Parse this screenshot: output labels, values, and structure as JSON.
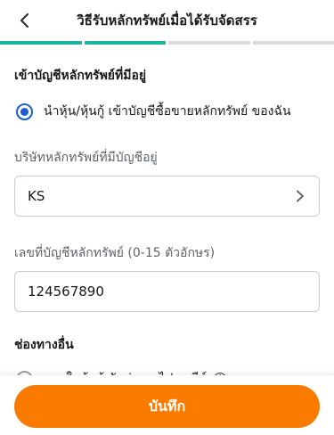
{
  "header": {
    "title": "วิธีรับหลักทรัพย์เมื่อได้รับจัดสรร",
    "back_icon": "chevron-left-icon"
  },
  "progress": {
    "steps_total": 4,
    "steps_active": 2,
    "active_color": "#20b2a0",
    "inactive_color": "#d9dbe0"
  },
  "account_section": {
    "title": "เข้าบัญชีหลักทรัพย์ที่มีอยู่",
    "radio_label": "นำหุ้น/หุ้นกู้ เข้าบัญชีซื้อขายหลักทรัพย์ ของฉัน",
    "radio_checked": true,
    "broker_label": "บริษัทหลักทรัพย์ที่มีบัญชีอยู่",
    "broker_value": "KS",
    "account_label": "เลขที่บัญชีหลักทรัพย์ (0-15 ตัวอักษร)",
    "account_value": "124567890"
  },
  "other_section": {
    "title": "ช่องทางอื่น",
    "radio_label": "ออกใบหุ้นกู้ จัดส่งทางไปรษณีย์",
    "radio_checked": false,
    "info_icon": "info-icon",
    "info_glyph": "i"
  },
  "footer": {
    "save_label": "บันทึก",
    "button_color": "#fb7a00"
  }
}
